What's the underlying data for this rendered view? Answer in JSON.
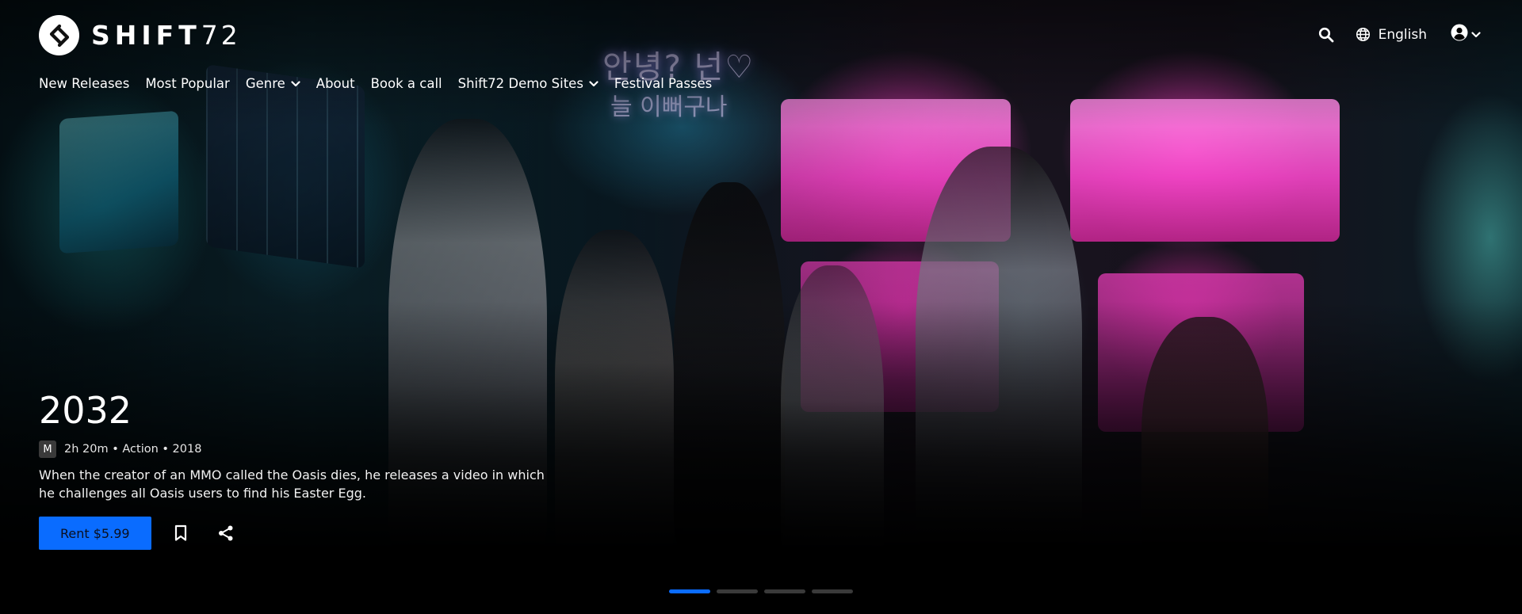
{
  "brand": {
    "name_prefix": "SHIFT",
    "name_suffix": "72"
  },
  "nav": {
    "items": [
      {
        "label": "New Releases"
      },
      {
        "label": "Most Popular"
      },
      {
        "label": "Genre",
        "has_dropdown": true
      },
      {
        "label": "About"
      },
      {
        "label": "Book a call"
      },
      {
        "label": "Shift72 Demo Sites",
        "has_dropdown": true
      },
      {
        "label": "Festival Passes"
      }
    ]
  },
  "header_right": {
    "search_icon": "search-icon",
    "language": "English",
    "language_icon": "globe-icon",
    "account_icon": "user-circle-icon"
  },
  "hero": {
    "title": "2032",
    "rating": "M",
    "meta": "2h 20m • Action • 2018",
    "description": "When the creator of an MMO called the Oasis dies, he releases a video in which he challenges all Oasis users to find his Easter Egg.",
    "rent_label": "Rent $5.99",
    "bookmark_icon": "bookmark-icon",
    "share_icon": "share-icon"
  },
  "carousel": {
    "slides": 4,
    "active_index": 0
  },
  "colors": {
    "accent": "#0a6cff",
    "background": "#000000",
    "text": "#ffffff",
    "inactive_dot": "#3a3a3a"
  }
}
